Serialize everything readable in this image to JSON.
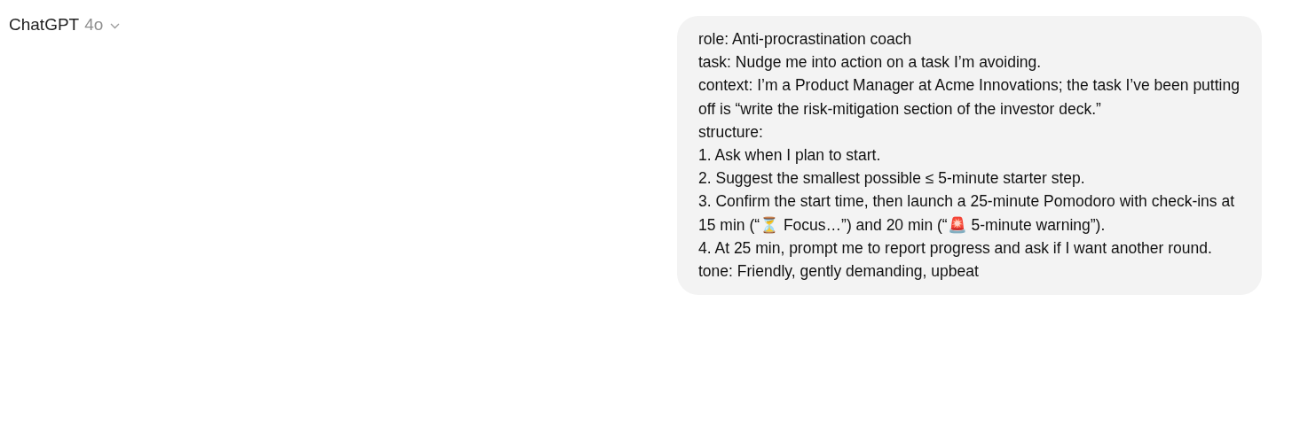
{
  "header": {
    "title": "ChatGPT",
    "model": "4o"
  },
  "message": {
    "lines": [
      "role: Anti-procrastination coach",
      "task: Nudge me into action on a task I’m avoiding.",
      "context: I’m a Product Manager at Acme Innovations; the task I’ve been putting off is “write the risk-mitigation section of the investor deck.”",
      "structure:",
      "1. Ask when I plan to start.",
      "2. Suggest the smallest possible ≤ 5-minute starter step.",
      "3. Confirm the start time, then launch a 25-minute Pomodoro with check-ins at 15 min (“⏳ Focus…”) and 20 min (“🚨 5-minute warning”).",
      "4. At 25 min, prompt me to report progress and ask if I want another round.",
      "tone: Friendly, gently demanding, upbeat"
    ]
  }
}
